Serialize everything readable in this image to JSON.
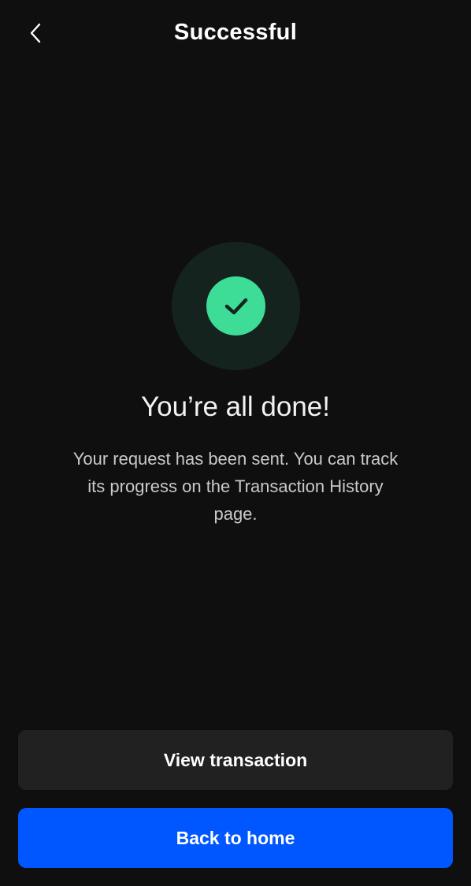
{
  "header": {
    "title": "Successful",
    "back_icon": "chevron-left-icon"
  },
  "status": {
    "icon": "check-icon",
    "headline": "You’re all done!",
    "message": "Your request has been sent. You can track its progress on the Transaction History page."
  },
  "actions": {
    "view_transaction_label": "View transaction",
    "back_home_label": "Back to home"
  },
  "colors": {
    "success": "#3ddc97",
    "success_bg": "#15231f",
    "primary": "#0057ff",
    "background": "#0f0f0f"
  }
}
